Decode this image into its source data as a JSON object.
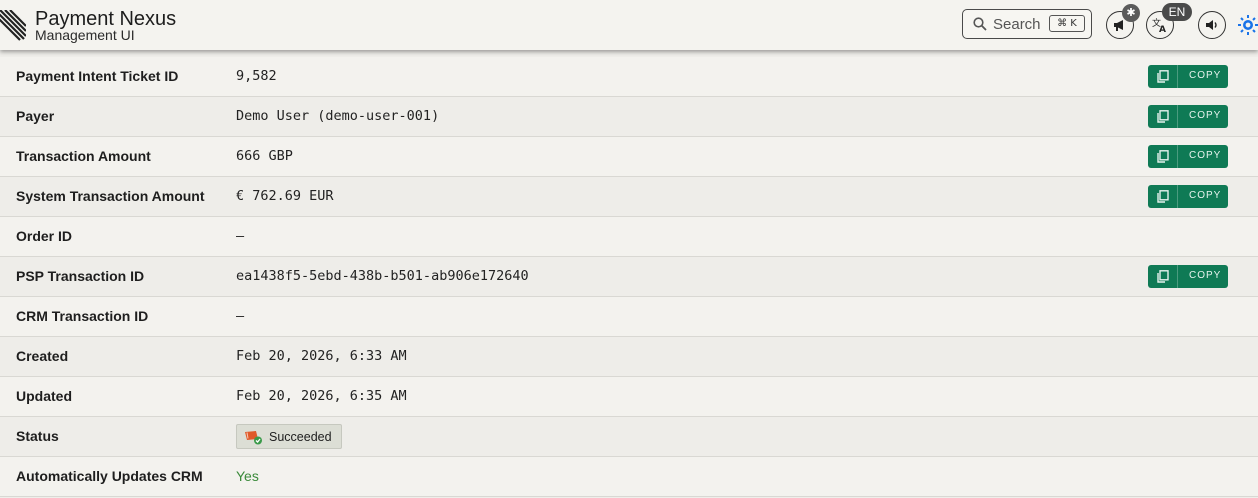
{
  "header": {
    "title": "Payment Nexus",
    "subtitle": "Management UI",
    "search": {
      "label": "Search",
      "shortcut": "⌘ K"
    },
    "notifications_badge": "✱",
    "language": "EN"
  },
  "rows": [
    {
      "label": "Payment Intent Ticket ID",
      "value": "9,582",
      "copy": "COPY"
    },
    {
      "label": "Payer",
      "value": "Demo User (demo-user-001)",
      "copy": "COPY"
    },
    {
      "label": "Transaction Amount",
      "value": "666 GBP",
      "copy": "COPY"
    },
    {
      "label": "System Transaction Amount",
      "value": "€ 762.69 EUR",
      "copy": "COPY"
    },
    {
      "label": "Order ID",
      "value": "–"
    },
    {
      "label": "PSP Transaction ID",
      "value": "ea1438f5-5ebd-438b-b501-ab906e172640",
      "copy": "COPY"
    },
    {
      "label": "CRM Transaction ID",
      "value": "–"
    },
    {
      "label": "Created",
      "value": "Feb 20, 2026, 6:33 AM"
    },
    {
      "label": "Updated",
      "value": "Feb 20, 2026, 6:35 AM"
    },
    {
      "label": "Status",
      "value": "Succeeded"
    },
    {
      "label": "Automatically Updates CRM",
      "value": "Yes"
    }
  ],
  "colors": {
    "copy_button": "#0f7a55",
    "yes": "#3a8a3a",
    "theme_toggle": "#1a73e8"
  },
  "icons": {
    "logo": "striped-logo-icon",
    "search": "search-icon",
    "announcements": "megaphone-icon",
    "language": "translate-icon",
    "sound": "speaker-icon",
    "theme": "sun-icon",
    "copy": "copy-icon",
    "status": "success-ticket-icon"
  }
}
